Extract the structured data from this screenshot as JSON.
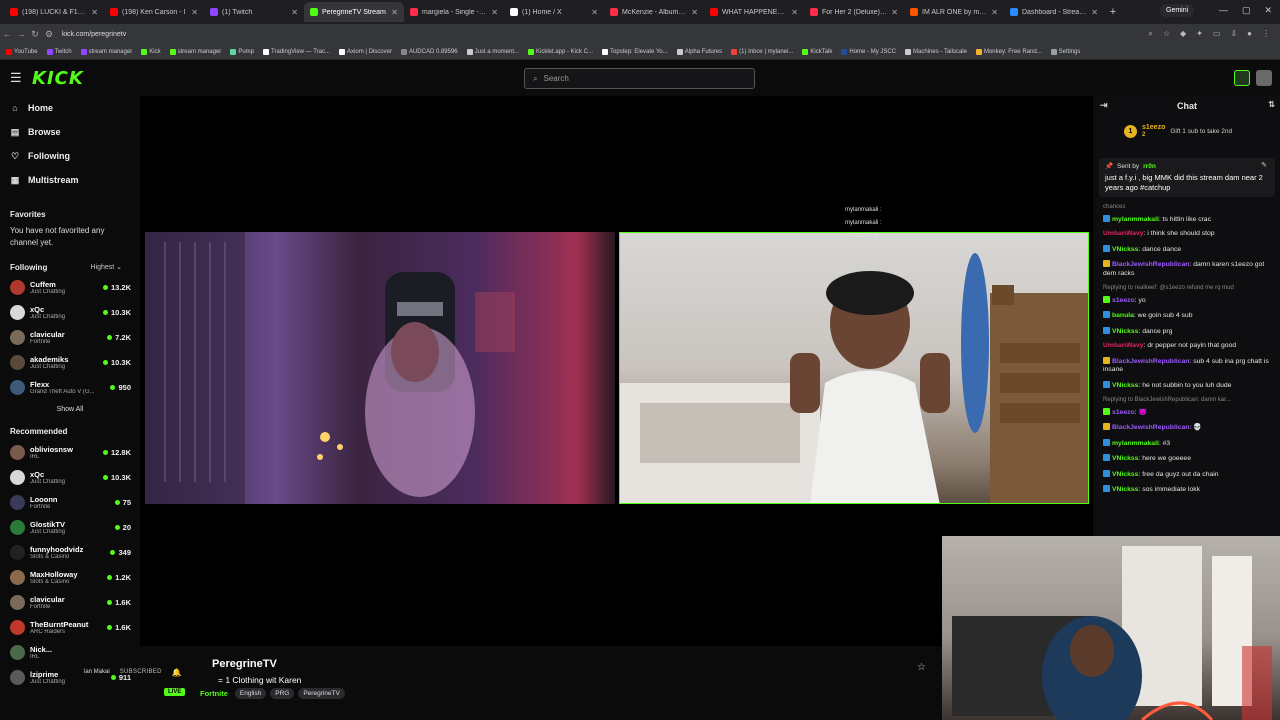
{
  "browser": {
    "tabs": [
      {
        "label": "(198) LUCKI & F1LTH",
        "color": "#ff0000",
        "active": false
      },
      {
        "label": "(198) Ken Carson - I",
        "color": "#ff0000",
        "active": false
      },
      {
        "label": "(1) Twitch",
        "color": "#9146ff",
        "active": false
      },
      {
        "label": "PeregrineTV Stream",
        "color": "#53fc18",
        "active": true
      },
      {
        "label": "margiela - Single - Album",
        "color": "#fa2d48",
        "active": false
      },
      {
        "label": "(1) Home / X",
        "color": "#ffffff",
        "active": false
      },
      {
        "label": "McKenzie - Album by Fe",
        "color": "#fa2d48",
        "active": false
      },
      {
        "label": "WHAT HAPPENED TO T",
        "color": "#ff0000",
        "active": false
      },
      {
        "label": "For Her 2 (Deluxe) - Alb",
        "color": "#fa2d48",
        "active": false
      },
      {
        "label": "IM ALR ONE by mylann",
        "color": "#ff5500",
        "active": false
      },
      {
        "label": "Dashboard - Streamable",
        "color": "#2b8cff",
        "active": false
      }
    ],
    "gemini_label": "Gemini",
    "url": "kick.com/peregrinetv",
    "bookmarks": [
      {
        "label": "YouTube",
        "color": "#ff0000"
      },
      {
        "label": "Twitch",
        "color": "#9146ff"
      },
      {
        "label": "stream manager",
        "color": "#9146ff"
      },
      {
        "label": "Kick",
        "color": "#53fc18"
      },
      {
        "label": "stream manager",
        "color": "#53fc18"
      },
      {
        "label": "Pump",
        "color": "#5fd3a3"
      },
      {
        "label": "TradingView — Trac...",
        "color": "#ffffff"
      },
      {
        "label": "Axiom | Discover",
        "color": "#ffffff"
      },
      {
        "label": "AUDCAD 0.89596",
        "color": "#888888"
      },
      {
        "label": "Just a moment...",
        "color": "#cccccc"
      },
      {
        "label": "Kicklet.app - Kick C...",
        "color": "#53fc18"
      },
      {
        "label": "Topstep: Elevate Yo...",
        "color": "#ffffff"
      },
      {
        "label": "Alpha Futures",
        "color": "#cccccc"
      },
      {
        "label": "(1) Inbox | mylanei...",
        "color": "#ea4335"
      },
      {
        "label": "KickTalk",
        "color": "#53fc18"
      },
      {
        "label": "Home - My JSCC",
        "color": "#1f4e9c"
      },
      {
        "label": "Machines - Tailscale",
        "color": "#cccccc"
      },
      {
        "label": "Monkey: Free Rand...",
        "color": "#f2b134"
      },
      {
        "label": "Settings",
        "color": "#9aa0a6"
      }
    ]
  },
  "kick": {
    "logo_text": "KICK",
    "search_placeholder": "Search",
    "nav": [
      {
        "label": "Home",
        "icon": "home-icon",
        "glyph": "⌂"
      },
      {
        "label": "Browse",
        "icon": "browse-icon",
        "glyph": "▤"
      },
      {
        "label": "Following",
        "icon": "heart-icon",
        "glyph": "♡"
      },
      {
        "label": "Multistream",
        "icon": "grid-icon",
        "glyph": "▦"
      }
    ],
    "favorites_title": "Favorites",
    "favorites_empty": "You have not favorited any channel yet.",
    "following_title": "Following",
    "following_sort": "Highest ⌄",
    "following": [
      {
        "name": "Cuffem",
        "category": "Just Chatting",
        "viewers": "13.2K",
        "avatar": "#b0392e"
      },
      {
        "name": "xQc",
        "category": "Just Chatting",
        "viewers": "10.3K",
        "avatar": "#d8d8d8"
      },
      {
        "name": "clavicular",
        "category": "Fortnite",
        "viewers": "7.2K",
        "avatar": "#7a6a5a"
      },
      {
        "name": "akademiks",
        "category": "Just Chatting",
        "viewers": "10.3K",
        "avatar": "#5a4a3a"
      },
      {
        "name": "Flexx",
        "category": "Grand Theft Auto V (G...",
        "viewers": "950",
        "avatar": "#3e5a7a"
      }
    ],
    "show_all": "Show All",
    "recommended_title": "Recommended",
    "recommended": [
      {
        "name": "obliviosnsw",
        "category": "IRL",
        "viewers": "12.8K",
        "avatar": "#7a5a4a"
      },
      {
        "name": "xQc",
        "category": "Just Chatting",
        "viewers": "10.3K",
        "avatar": "#d8d8d8"
      },
      {
        "name": "Looonn",
        "category": "Fortnite",
        "viewers": "75",
        "avatar": "#3a3a5a"
      },
      {
        "name": "GlostikTV",
        "category": "Just Chatting",
        "viewers": "20",
        "avatar": "#2a7a3a"
      },
      {
        "name": "funnyhoodvidz",
        "category": "Slots & Casino",
        "viewers": "349",
        "avatar": "#222222"
      },
      {
        "name": "MaxHolloway",
        "category": "Slots & Casino",
        "viewers": "1.2K",
        "avatar": "#8a6a4a"
      },
      {
        "name": "clavicular",
        "category": "Fortnite",
        "viewers": "1.6K",
        "avatar": "#7a6a5a"
      },
      {
        "name": "TheBurntPeanut",
        "category": "ARC Raiders",
        "viewers": "1.6K",
        "avatar": "#c0392b"
      },
      {
        "name": "Nick...",
        "category": "IRL",
        "viewers": "",
        "avatar": "#4a6a4a"
      },
      {
        "name": "lziprime",
        "category": "Just Chatting",
        "viewers": "911",
        "avatar": "#5a5a5a"
      }
    ]
  },
  "video": {
    "cam_overlay_lines": [
      "mylanmakali : ",
      "mylanmakali : ",
      "mylanmakali : "
    ]
  },
  "chat": {
    "title": "Chat",
    "gift_rank": "1",
    "gift_user": "s1eezo",
    "gift_count": "2",
    "gift_text": "Gift 1 sub to take 2nd",
    "pinned_label": "Sent by",
    "pinned_user": "rr0n",
    "pinned_text": "just a f.y.i , big MMK did this stream dam near 2 years ago #catchup",
    "messages": [
      {
        "user": "",
        "color": "#888888",
        "text": "chances",
        "reply": true,
        "badge": ""
      },
      {
        "user": "mylanmmakali",
        "color": "#53fc18",
        "text": ": ts hittin like crac",
        "reply": false,
        "badge": "#2f8fdf"
      },
      {
        "user": "UmbanWavy",
        "color": "#e0245e",
        "text": ": i think she should stop",
        "reply": false,
        "badge": ""
      },
      {
        "user": "VNickss",
        "color": "#53fc18",
        "text": ": dance dance",
        "reply": false,
        "badge": "#2f8fdf"
      },
      {
        "user": "BlackJewishRepublican",
        "color": "#9b59ff",
        "text": ": damn karen s1eezo got dem racks",
        "reply": false,
        "badge": "#e6b320"
      },
      {
        "user": "",
        "color": "#888888",
        "text": "Replying to realkeef: @s1eezo refund me rq mud",
        "reply": true,
        "badge": ""
      },
      {
        "user": "s1eezo",
        "color": "#9b59ff",
        "text": ": yo",
        "reply": false,
        "badge": "#53fc18"
      },
      {
        "user": "banula",
        "color": "#53fc18",
        "text": ": we goin sub 4 sub",
        "reply": false,
        "badge": "#2f8fdf"
      },
      {
        "user": "VNickss",
        "color": "#53fc18",
        "text": ": dance prg",
        "reply": false,
        "badge": "#2f8fdf"
      },
      {
        "user": "UmbanWavy",
        "color": "#e0245e",
        "text": ": dr pepper not payin that good",
        "reply": false,
        "badge": ""
      },
      {
        "user": "BlackJewishRepublican",
        "color": "#9b59ff",
        "text": ": sub 4 sub ina prg chatt is insane",
        "reply": false,
        "badge": "#e6b320"
      },
      {
        "user": "VNickss",
        "color": "#53fc18",
        "text": ": he not subbin to you luh dude",
        "reply": false,
        "badge": "#2f8fdf"
      },
      {
        "user": "",
        "color": "#888888",
        "text": "Replying to BlackJewishRepublican: damn kar...",
        "reply": true,
        "badge": ""
      },
      {
        "user": "s1eezo",
        "color": "#9b59ff",
        "text": ": 😈",
        "reply": false,
        "badge": "#53fc18"
      },
      {
        "user": "BlackJewishRepublican",
        "color": "#9b59ff",
        "text": ": 💀",
        "reply": false,
        "badge": "#e6b320"
      },
      {
        "user": "mylanmmakali",
        "color": "#53fc18",
        "text": ": #3",
        "reply": false,
        "badge": "#2f8fdf"
      },
      {
        "user": "VNickss",
        "color": "#53fc18",
        "text": ": here we goeeee",
        "reply": false,
        "badge": "#2f8fdf"
      },
      {
        "user": "VNickss",
        "color": "#53fc18",
        "text": ": free da guyz out da chain",
        "reply": false,
        "badge": "#2f8fdf"
      },
      {
        "user": "VNickss",
        "color": "#53fc18",
        "text": ": sos immediate lokk",
        "reply": false,
        "badge": "#2f8fdf"
      }
    ]
  },
  "stream": {
    "channel_name": "PeregrineTV",
    "live_label": "LIVE",
    "title": "= 1 Clothing wit Karen",
    "category": "Fortnite",
    "tags": [
      "English",
      "PRG",
      "PeregrineTV"
    ],
    "overlay_user": "lan Makai",
    "subscribed_label": "SUBSCRIBED"
  }
}
